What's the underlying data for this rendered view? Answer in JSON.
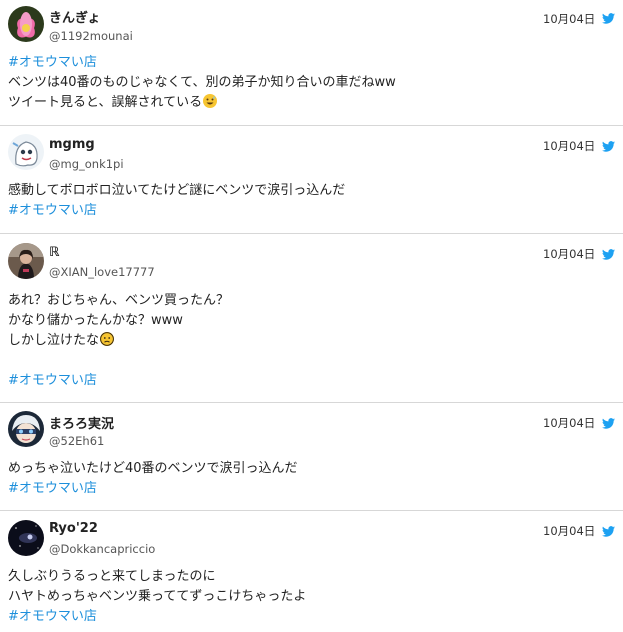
{
  "colors": {
    "hashtag": "#1d8fdb",
    "bird": "#1da1f2",
    "divider": "#d7d7d7"
  },
  "tweets": [
    {
      "name": "きんぎょ",
      "handle": "@1192mounai",
      "date": "10月04日",
      "avatar_icon": "lotus-flower-avatar",
      "lines": [
        "#オモウマい店",
        "ベンツは40番のものじゃなくて、別の弟子か知り合いの車だねww",
        "ツイート見ると、誤解されている"
      ],
      "emoji": "grinning-sweat-emoji"
    },
    {
      "name": "mgmg",
      "handle": "@mg_onk1pi",
      "date": "10月04日",
      "avatar_icon": "white-ghost-character-avatar",
      "lines": [
        "感動してボロボロ泣いてたけど謎にベンツで涙引っ込んだ",
        "#オモウマい店"
      ]
    },
    {
      "name": "ℝ",
      "handle": "@XIAN_love17777",
      "date": "10月04日",
      "avatar_icon": "person-photo-avatar",
      "lines": [
        "あれ？おじちゃん、ベンツ買ったん？",
        "かなり儲かったんかな？www",
        "しかし泣けたな",
        "#オモウマい店"
      ],
      "emoji": "sad-face-emoji"
    },
    {
      "name": "まろろ実況",
      "handle": "@52Eh61",
      "date": "10月04日",
      "avatar_icon": "anime-character-avatar",
      "lines": [
        "めっちゃ泣いたけど40番のベンツで涙引っ込んだ",
        "#オモウマい店"
      ]
    },
    {
      "name": "Ryo'22",
      "handle": "@Dokkancapriccio",
      "date": "10月04日",
      "avatar_icon": "night-sky-avatar",
      "lines": [
        "久しぶりうるっと来てしまったのに",
        "ハヤトめっちゃベンツ乗っててずっこけちゃったよ",
        "#オモウマい店"
      ]
    }
  ]
}
